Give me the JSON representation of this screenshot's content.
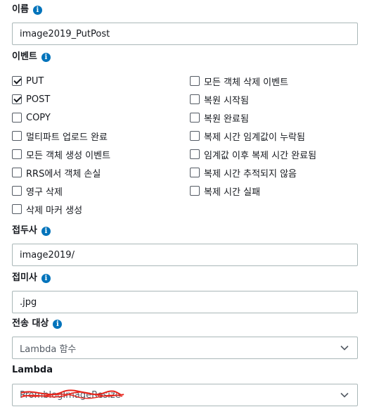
{
  "name": {
    "label": "이름",
    "value": "image2019_PutPost"
  },
  "events": {
    "label": "이벤트",
    "left": [
      {
        "label": "PUT",
        "checked": true
      },
      {
        "label": "POST",
        "checked": true
      },
      {
        "label": "COPY",
        "checked": false
      },
      {
        "label": "멀티파트 업로드 완료",
        "checked": false
      },
      {
        "label": "모든 객체 생성 이벤트",
        "checked": false
      },
      {
        "label": "RRS에서 객체 손실",
        "checked": false
      },
      {
        "label": "영구 삭제",
        "checked": false
      },
      {
        "label": "삭제 마커 생성",
        "checked": false
      }
    ],
    "right": [
      {
        "label": "모든 객체 삭제 이벤트",
        "checked": false
      },
      {
        "label": "복원 시작됨",
        "checked": false
      },
      {
        "label": "복원 완료됨",
        "checked": false
      },
      {
        "label": "복제 시간 임계값이 누락됨",
        "checked": false
      },
      {
        "label": "임계값 이후 복제 시간 완료됨",
        "checked": false
      },
      {
        "label": "복제 시간 추적되지 않음",
        "checked": false
      },
      {
        "label": "복제 시간 실패",
        "checked": false
      }
    ]
  },
  "prefix": {
    "label": "접두사",
    "value": "image2019/"
  },
  "suffix": {
    "label": "접미사",
    "value": ".jpg"
  },
  "destination": {
    "label": "전송 대상",
    "value": "Lambda 함수"
  },
  "lambda": {
    "label": "Lambda",
    "value": "PromblogImageResize",
    "redaction_color": "#e8241b"
  },
  "icons": {
    "info": "info-icon",
    "chevron": "chevron-down-icon",
    "check": "check-icon"
  },
  "colors": {
    "info": "#0073bb",
    "border": "#aab7b8",
    "text": "#16191f"
  }
}
